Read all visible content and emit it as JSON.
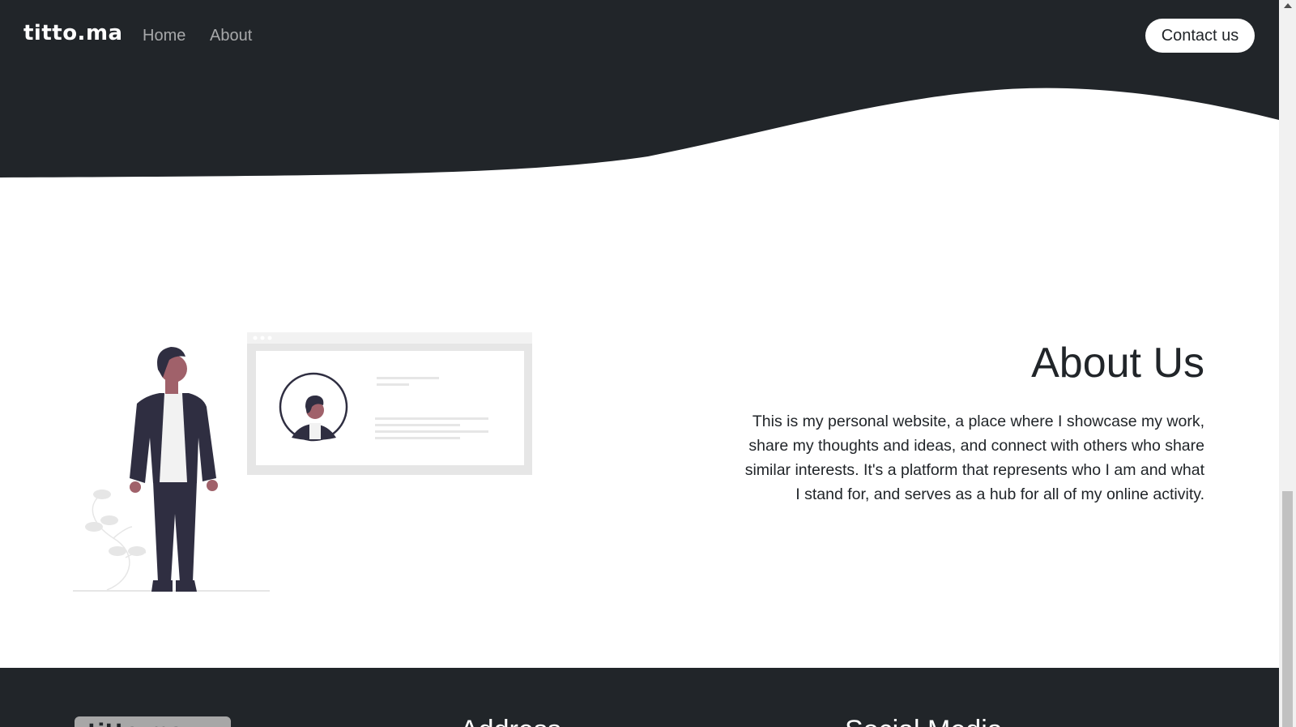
{
  "navbar": {
    "brand": "titto.ma",
    "links": [
      {
        "label": "Home"
      },
      {
        "label": "About"
      }
    ],
    "contact_label": "Contact us"
  },
  "about": {
    "title": "About Us",
    "text": "This is my personal website, a place where I showcase my work, share my thoughts and ideas, and connect with others who share similar interests. It's a platform that represents who I am and what I stand for, and serves as a hub for all of my online activity."
  },
  "footer": {
    "logo_text": "titto.ma",
    "address_heading": "Address",
    "social_heading": "Social Media"
  },
  "colors": {
    "dark": "#212529",
    "nav_link": "rgba(255,255,255,0.6)",
    "illustration_accent": "#a0616a",
    "illustration_dark": "#2f2e41"
  }
}
